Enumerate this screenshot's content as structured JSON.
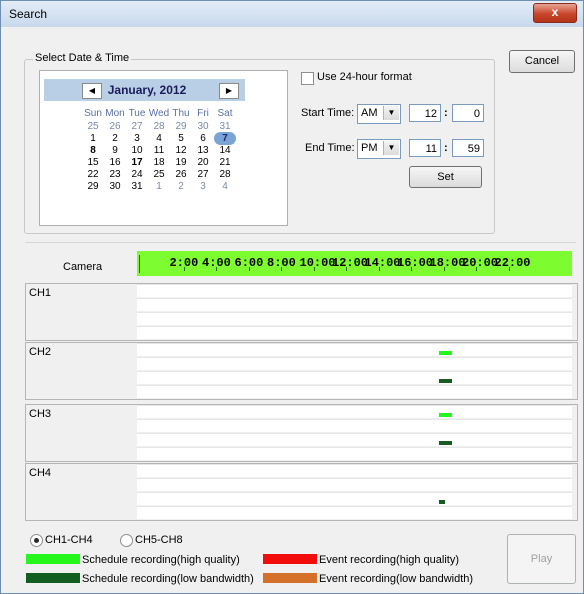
{
  "window": {
    "title": "Search",
    "close_label": "x"
  },
  "date_time": {
    "group_title": "Select Date & Time",
    "calendar": {
      "month_title": "January, 2012",
      "prev_label": "◀",
      "next_label": "▶",
      "weekdays": [
        "Sun",
        "Mon",
        "Tue",
        "Wed",
        "Thu",
        "Fri",
        "Sat"
      ],
      "weeks": [
        [
          "25",
          "26",
          "27",
          "28",
          "29",
          "30",
          "31"
        ],
        [
          "1",
          "2",
          "3",
          "4",
          "5",
          "6",
          "7"
        ],
        [
          "8",
          "9",
          "10",
          "11",
          "12",
          "13",
          "14"
        ],
        [
          "15",
          "16",
          "17",
          "18",
          "19",
          "20",
          "21"
        ],
        [
          "22",
          "23",
          "24",
          "25",
          "26",
          "27",
          "28"
        ],
        [
          "29",
          "30",
          "31",
          "1",
          "2",
          "3",
          "4"
        ]
      ],
      "selected_day": "7"
    },
    "use_24h_label": "Use 24-hour format",
    "use_24h_checked": false,
    "start_time_label": "Start Time:",
    "start_ampm": "AM",
    "start_hour": "12",
    "start_minute": "0",
    "end_time_label": "End Time:",
    "end_ampm": "PM",
    "end_hour": "11",
    "end_minute": "59",
    "time_separator": ":",
    "set_label": "Set"
  },
  "cancel_label": "Cancel",
  "timeline": {
    "camera_label": "Camera",
    "hours": [
      "2:00",
      "4:00",
      "6:00",
      "8:00",
      "10:00",
      "12:00",
      "14:00",
      "16:00",
      "18:00",
      "20:00",
      "22:00"
    ]
  },
  "channels": [
    {
      "label": "CH1",
      "schedule_high": [],
      "schedule_low": []
    },
    {
      "label": "CH2",
      "schedule_high": [
        [
          17.75,
          18.5
        ]
      ],
      "schedule_low": [
        [
          17.75,
          18.5
        ]
      ]
    },
    {
      "label": "CH3",
      "schedule_high": [
        [
          17.75,
          18.5
        ]
      ],
      "schedule_low": [
        [
          17.75,
          18.5
        ]
      ]
    },
    {
      "label": "CH4",
      "schedule_high": [],
      "schedule_low": [
        [
          17.75,
          18.1
        ]
      ]
    }
  ],
  "channel_group": {
    "option_a": "CH1-CH4",
    "option_b": "CH5-CH8",
    "selected": "CH1-CH4"
  },
  "legend": {
    "schedule_high": {
      "label": "Schedule recording(high quality)",
      "color": "#25f61c"
    },
    "schedule_low": {
      "label": "Schedule recording(low bandwidth)",
      "color": "#135d20"
    },
    "event_high": {
      "label": "Event recording(high quality)",
      "color": "#f20d0d"
    },
    "event_low": {
      "label": "Event recording(low bandwidth)",
      "color": "#d4702a"
    }
  },
  "play_label": "Play"
}
